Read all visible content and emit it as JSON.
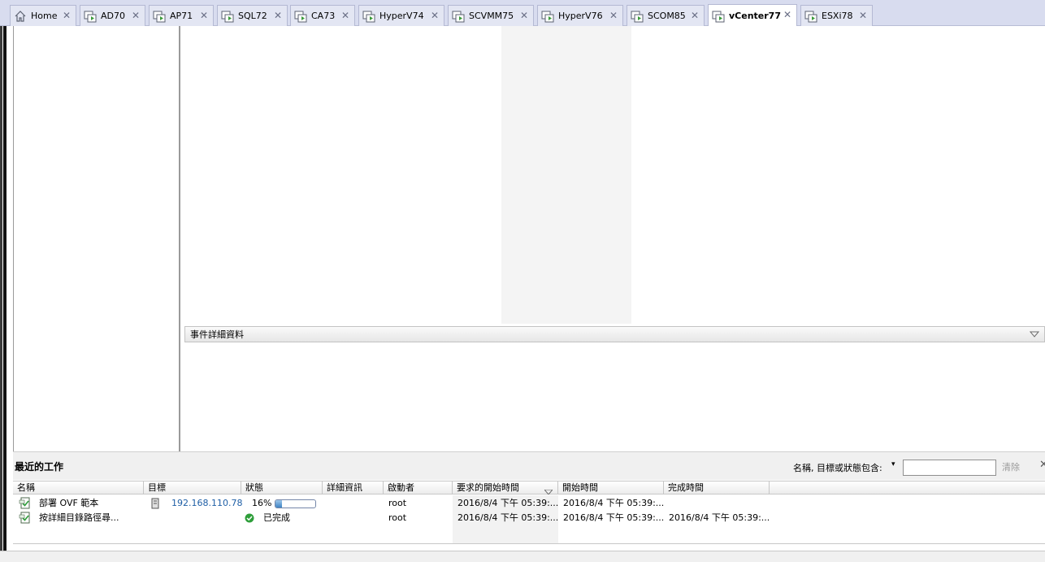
{
  "tabs": [
    {
      "label": "Home",
      "icon": "home-icon",
      "active": false
    },
    {
      "label": "AD70",
      "icon": "vm-console-icon",
      "active": false
    },
    {
      "label": "AP71",
      "icon": "vm-console-icon",
      "active": false
    },
    {
      "label": "SQL72",
      "icon": "vm-console-icon",
      "active": false
    },
    {
      "label": "CA73",
      "icon": "vm-console-icon",
      "active": false
    },
    {
      "label": "HyperV74",
      "icon": "vm-console-icon",
      "active": false
    },
    {
      "label": "SCVMM75",
      "icon": "vm-console-icon",
      "active": false
    },
    {
      "label": "HyperV76",
      "icon": "vm-console-icon",
      "active": false
    },
    {
      "label": "SCOM85",
      "icon": "vm-console-icon",
      "active": false
    },
    {
      "label": "vCenter77",
      "icon": "vm-console-icon",
      "active": true
    },
    {
      "label": "ESXi78",
      "icon": "vm-console-icon",
      "active": false
    }
  ],
  "tab_close_glyph": "✕",
  "event_details": {
    "title": "事件詳細資料"
  },
  "recent_tasks": {
    "title": "最近的工作",
    "filter_label": "名稱, 目標或狀態包含:",
    "filter_dropdown_glyph": "▾",
    "filter_value": "",
    "clear_label": "清除",
    "close_glyph": "✕",
    "columns": [
      "名稱",
      "目標",
      "狀態",
      "詳細資訊",
      "啟動者",
      "要求的開始時間",
      "開始時間",
      "完成時間"
    ],
    "rows": [
      {
        "name": "部署 OVF 範本",
        "target": "192.168.110.78",
        "status": "16%",
        "progress": 16,
        "details": "",
        "initiator": "root",
        "requested_start": "2016/8/4 下午 05:39:...",
        "start": "2016/8/4 下午 05:39:...",
        "completed": ""
      },
      {
        "name": "按詳細目錄路徑尋...",
        "target": "",
        "status": "已完成",
        "progress": null,
        "details": "",
        "initiator": "root",
        "requested_start": "2016/8/4 下午 05:39:...",
        "start": "2016/8/4 下午 05:39:...",
        "completed": "2016/8/4 下午 05:39:..."
      }
    ]
  },
  "colors": {
    "tab_bg": "#e3e6f3",
    "tabbar_bg": "#d8dcef",
    "link": "#1f5fa6",
    "success": "#2e9e3a"
  }
}
